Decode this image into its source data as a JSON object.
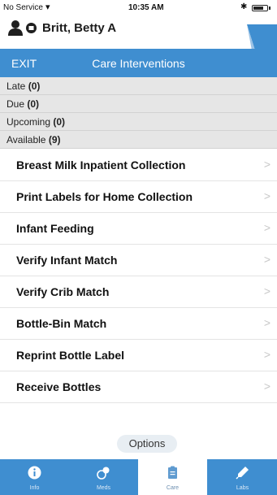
{
  "status_bar": {
    "carrier": "No Service",
    "time": "10:35 AM"
  },
  "patient": {
    "name": "Britt, Betty A",
    "icons": [
      "person-icon",
      "record-icon"
    ]
  },
  "navbar": {
    "exit_label": "EXIT",
    "title": "Care Interventions"
  },
  "sections": {
    "late": {
      "label": "Late",
      "count": "(0)"
    },
    "due": {
      "label": "Due",
      "count": "(0)"
    },
    "upcoming": {
      "label": "Upcoming",
      "count": "(0)"
    },
    "available": {
      "label": "Available",
      "count": "(9)"
    }
  },
  "interventions": [
    "Breast Milk Inpatient Collection",
    "Print Labels for Home Collection",
    "Infant Feeding",
    "Verify Infant Match",
    "Verify Crib Match",
    "Bottle-Bin Match",
    "Reprint Bottle Label",
    "Receive Bottles"
  ],
  "chevron": ">",
  "options_label": "Options",
  "tabs": [
    {
      "label": "Info",
      "icon": "info-icon",
      "active": false
    },
    {
      "label": "Meds",
      "icon": "meds-icon",
      "active": false
    },
    {
      "label": "Care",
      "icon": "clipboard-icon",
      "active": true
    },
    {
      "label": "Labs",
      "icon": "dropper-icon",
      "active": false
    }
  ],
  "colors": {
    "accent": "#3f8ed0",
    "section_bg": "#e6e6e6"
  }
}
